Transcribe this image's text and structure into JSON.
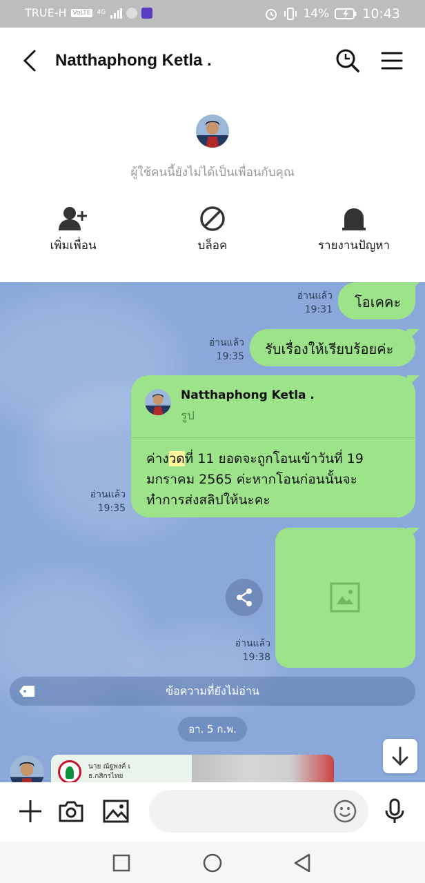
{
  "status_bar": {
    "carrier": "TRUE-H",
    "volte": "VoLTE",
    "network": "4G",
    "battery": "14%",
    "time": "10:43"
  },
  "header": {
    "title": "Natthaphong Ketla ."
  },
  "profile": {
    "not_friend_text": "ผู้ใช้คนนี้ยังไม่ได้เป็นเพื่อนกับคุณ",
    "actions": [
      {
        "label": "เพิ่มเพื่อน",
        "icon": "add-friend-icon"
      },
      {
        "label": "บล็อค",
        "icon": "block-icon"
      },
      {
        "label": "รายงานปัญหา",
        "icon": "report-icon"
      }
    ]
  },
  "messages": [
    {
      "type": "text",
      "text": "โอเคคะ",
      "read": "อ่านแล้ว",
      "time": "19:31"
    },
    {
      "type": "text",
      "text": "รับเรื่องให้เรียบร้อยค่ะ",
      "read": "อ่านแล้ว",
      "time": "19:35"
    },
    {
      "type": "reply",
      "reply_to_name": "Natthaphong Ketla .",
      "reply_to_kind": "รูป",
      "text_before": "ค่าง",
      "highlight": "วด",
      "text_line1_after": "ที่ 11 ยอดจะถูกโอนเข้าวันที่ 19",
      "text_line2": "มกราคม 2565 ค่ะหากโอนก่อนนั้นจะ",
      "text_line3": "ทำการส่งสลิปให้นะคะ",
      "read": "อ่านแล้ว",
      "time": "19:35"
    },
    {
      "type": "image",
      "read": "อ่านแล้ว",
      "time": "19:38"
    }
  ],
  "chat": {
    "unread_label": "ข้อความที่ยังไม่อ่าน",
    "date_label": "อา. 5 ก.พ.",
    "slip": {
      "line1": "นาย ณัฐพงค์ เ",
      "line2": "ธ.กสิกรไทย"
    }
  },
  "colors": {
    "bubble": "#9de38a",
    "chat_bg": "#8aa9da",
    "highlight": "#fff59a"
  }
}
